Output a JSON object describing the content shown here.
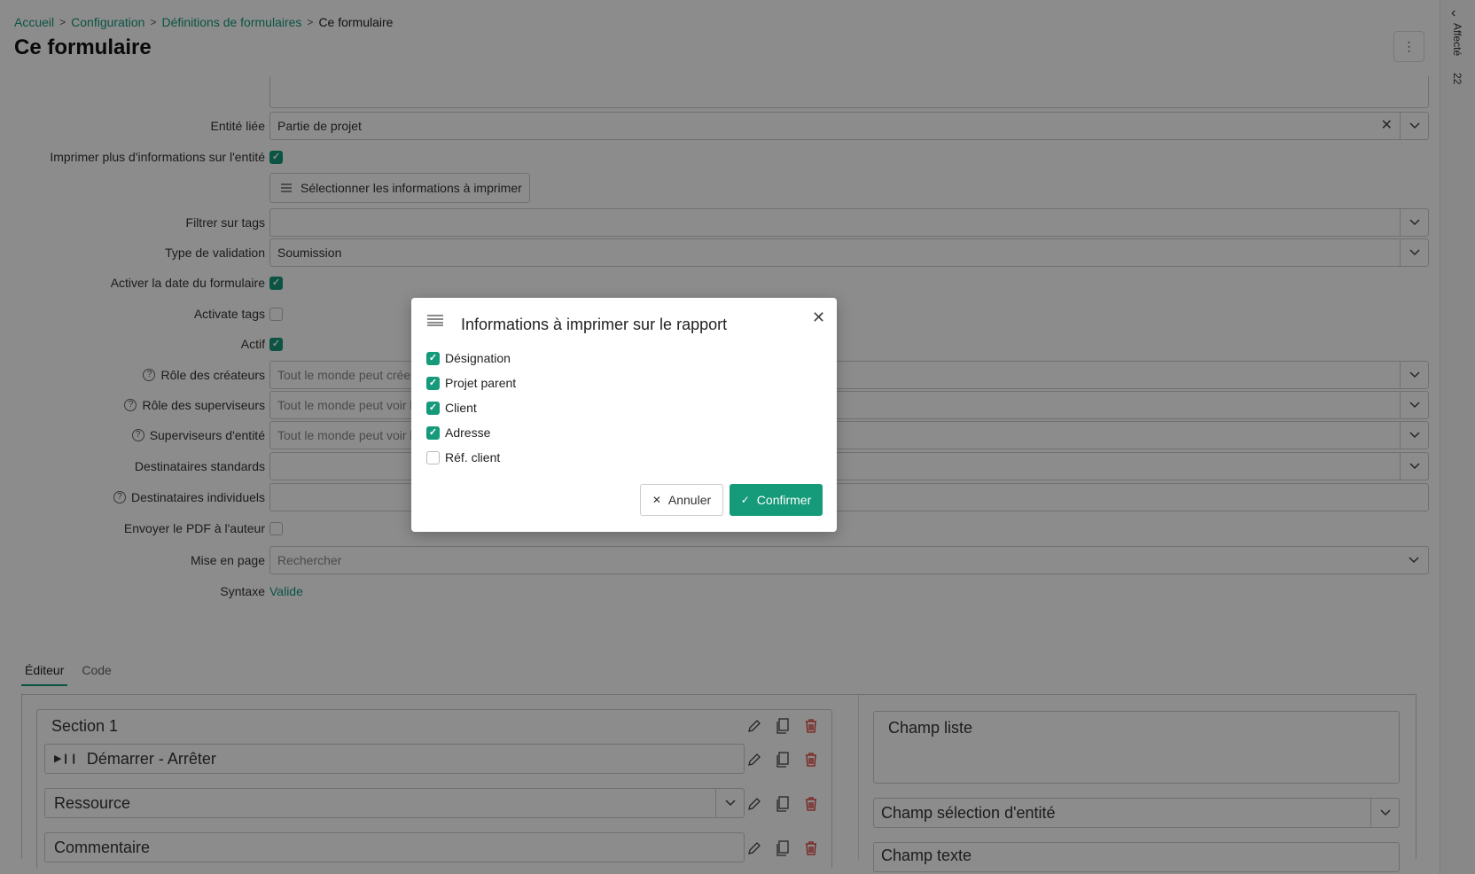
{
  "breadcrumb": {
    "items": [
      "Accueil",
      "Configuration",
      "Définitions de formulaires"
    ],
    "current": "Ce formulaire"
  },
  "page": {
    "title": "Ce formulaire",
    "more_icon": "⋮"
  },
  "sidebar_right": {
    "label": "Affecté",
    "count": "22"
  },
  "form": {
    "entite_liee": {
      "label": "Entité liée",
      "value": "Partie de projet"
    },
    "imprimer_plus": {
      "label": "Imprimer plus d'informations sur l'entité",
      "checked": true
    },
    "select_info_button": "Sélectionner les informations à imprimer",
    "filtrer_tags": {
      "label": "Filtrer sur tags",
      "value": ""
    },
    "type_validation": {
      "label": "Type de validation",
      "value": "Soumission"
    },
    "activer_date": {
      "label": "Activer la date du formulaire",
      "checked": true
    },
    "activate_tags": {
      "label": "Activate tags",
      "checked": false
    },
    "actif": {
      "label": "Actif",
      "checked": true
    },
    "role_createurs": {
      "label": "Rôle des créateurs",
      "placeholder": "Tout le monde peut créer d"
    },
    "role_superviseurs": {
      "label": "Rôle des superviseurs",
      "placeholder": "Tout le monde peut voir les"
    },
    "superviseurs_entite": {
      "label": "Superviseurs d'entité",
      "placeholder": "Tout le monde peut voir les"
    },
    "destinataires_standards": {
      "label": "Destinataires standards",
      "value": ""
    },
    "destinataires_individuels": {
      "label": "Destinataires individuels",
      "value": ""
    },
    "envoyer_pdf": {
      "label": "Envoyer le PDF à l'auteur",
      "checked": false
    },
    "mise_en_page": {
      "label": "Mise en page",
      "placeholder": "Rechercher"
    },
    "syntaxe": {
      "label": "Syntaxe",
      "value": "Valide"
    }
  },
  "tabs": [
    "Éditeur",
    "Code"
  ],
  "editor": {
    "section_title": "Section 1",
    "fields": [
      "Démarrer - Arrêter",
      "Ressource",
      "Commentaire"
    ],
    "right_fields": [
      "Champ liste",
      "Champ sélection d'entité",
      "Champ texte"
    ]
  },
  "modal": {
    "title": "Informations à imprimer sur le rapport",
    "options": [
      {
        "label": "Désignation",
        "checked": true
      },
      {
        "label": "Projet parent",
        "checked": true
      },
      {
        "label": "Client",
        "checked": true
      },
      {
        "label": "Adresse",
        "checked": true
      },
      {
        "label": "Réf. client",
        "checked": false
      }
    ],
    "cancel_label": "Annuler",
    "confirm_label": "Confirmer"
  },
  "colors": {
    "accent": "#159a7a",
    "delete": "#d9342b",
    "overlay": "rgba(0,0,0,0.45)"
  }
}
